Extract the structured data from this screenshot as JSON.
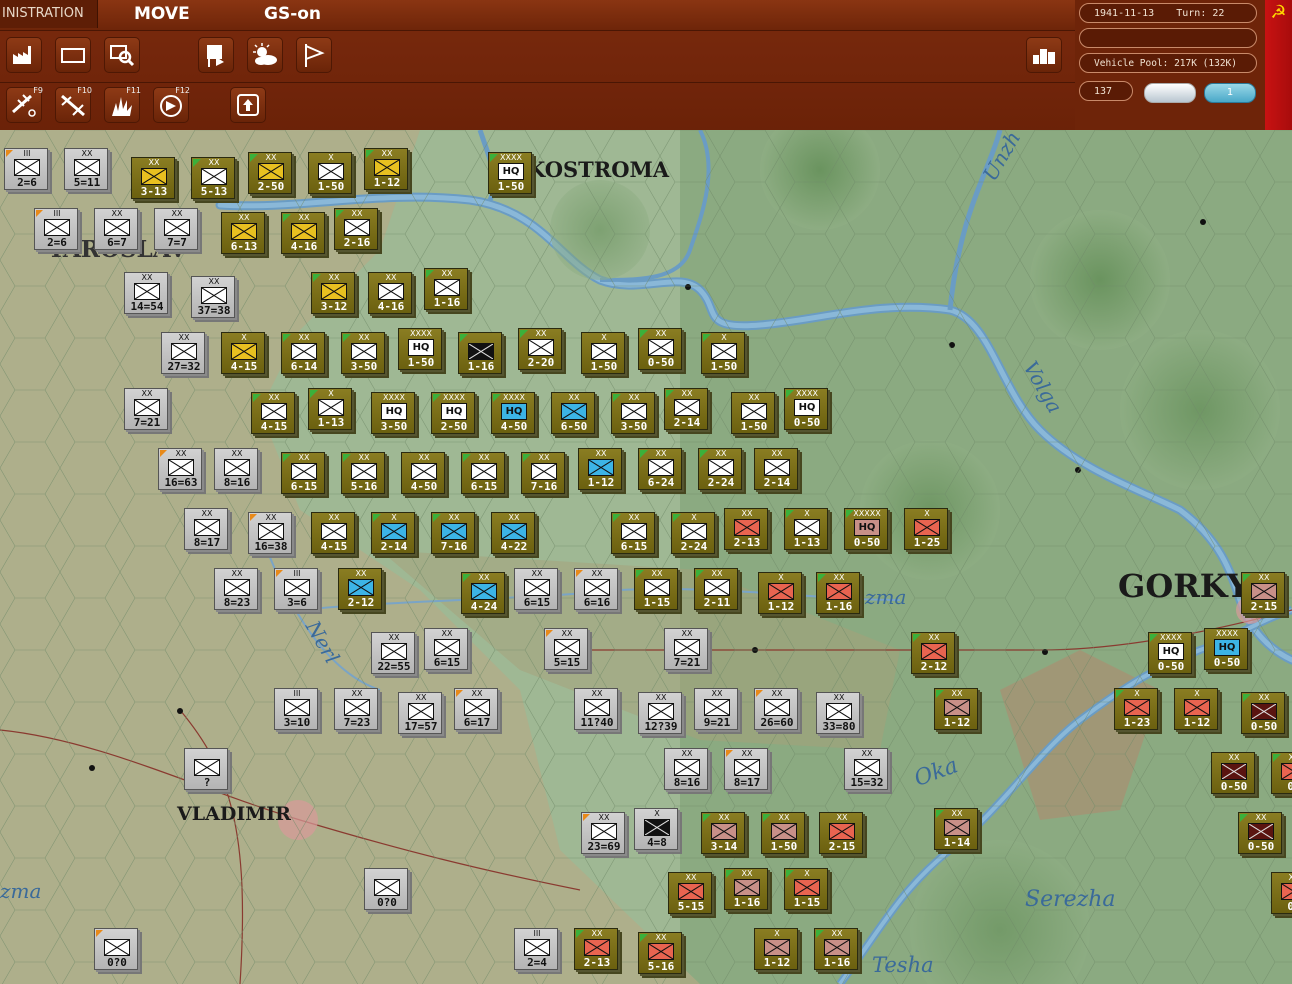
{
  "menu": {
    "admin_tab": "INISTRATION",
    "move_tab": "MOVE",
    "gs_tab": "GS-on"
  },
  "toolbar_row1": [
    {
      "name": "production-icon",
      "glyph": "factory"
    },
    {
      "name": "map-mode-icon",
      "glyph": "rect"
    },
    {
      "name": "search-unit-icon",
      "glyph": "magnify"
    },
    {
      "name": "flag-hq-icon",
      "glyph": "flagdoc"
    },
    {
      "name": "weather-icon",
      "glyph": "weather"
    },
    {
      "name": "victory-flag-icon",
      "glyph": "flag"
    }
  ],
  "toolbar_row2": [
    {
      "name": "air-recon-icon",
      "key": "F9"
    },
    {
      "name": "air-interdiction-icon",
      "key": "F10"
    },
    {
      "name": "bombardment-icon",
      "key": "F11"
    },
    {
      "name": "air-transfer-icon",
      "key": "F12"
    },
    {
      "name": "upload-icon",
      "key": ""
    }
  ],
  "status": {
    "date": "1941-11-13",
    "turn": "Turn: 22",
    "empty_field": "",
    "vehicle_pool": "Vehicle Pool: 217K (132K)",
    "counter_value": "137",
    "badge_number": "1"
  },
  "map_labels": {
    "city_kostroma": "KOSTROMA",
    "city_yaroslavl": "YAROSLAV",
    "city_vladimir": "VLADIMIR",
    "city_gorky": "GORKY",
    "river_volga": "Volga",
    "river_oka": "Oka",
    "river_unzha": "Unzh",
    "river_serezhka": "Serezha",
    "river_tesha": "Tesha",
    "river_nerl": "Nerl",
    "river_klyazma": "zma",
    "river_klyazma_west": "zma"
  },
  "colors": {
    "axis_counter": "#8a7d22",
    "soviet_counter": "#c8c8c8",
    "inf_yellow": "#e8c020",
    "inf_white": "#ffffff",
    "inf_cyan": "#3cb4e6",
    "inf_red": "#e86450",
    "inf_pink": "#c89088",
    "inf_dark": "#5a1410",
    "hq_cyan": "#3cb4e6"
  },
  "units": [
    {
      "side": "sov",
      "size": "III",
      "val": "2=6",
      "fill": "white"
    },
    {
      "side": "sov",
      "size": "XX",
      "val": "5=11",
      "fill": "white"
    },
    {
      "side": "axis",
      "size": "XX",
      "val": "3-13",
      "fill": "yellow"
    },
    {
      "side": "axis",
      "size": "XX",
      "val": "5-13",
      "fill": "white"
    },
    {
      "side": "axis",
      "size": "XX",
      "val": "2-50",
      "fill": "yellow"
    },
    {
      "side": "axis",
      "size": "X",
      "val": "1-50",
      "fill": "white"
    },
    {
      "side": "axis",
      "size": "XX",
      "val": "1-12",
      "fill": "yellow"
    },
    {
      "side": "axis",
      "size": "XXXX",
      "val": "1-50",
      "fill": "hq"
    },
    {
      "side": "sov",
      "size": "III",
      "val": "2=6",
      "fill": "white"
    },
    {
      "side": "sov",
      "size": "XX",
      "val": "6=7",
      "fill": "white"
    },
    {
      "side": "sov",
      "size": "XX",
      "val": "7=7",
      "fill": "white"
    },
    {
      "side": "axis",
      "size": "XX",
      "val": "6-13",
      "fill": "yellow"
    },
    {
      "side": "axis",
      "size": "XX",
      "val": "4-16",
      "fill": "yellow"
    },
    {
      "side": "axis",
      "size": "XX",
      "val": "2-16",
      "fill": "white"
    },
    {
      "side": "sov",
      "size": "XX",
      "val": "14=54",
      "fill": "white"
    },
    {
      "side": "sov",
      "size": "XX",
      "val": "37=38",
      "fill": "white"
    },
    {
      "side": "axis",
      "size": "XX",
      "val": "3-12",
      "fill": "yellow"
    },
    {
      "side": "axis",
      "size": "XX",
      "val": "4-16",
      "fill": "white"
    },
    {
      "side": "axis",
      "size": "XX",
      "val": "1-16",
      "fill": "white"
    },
    {
      "side": "sov",
      "size": "XX",
      "val": "27=32",
      "fill": "white"
    },
    {
      "side": "axis",
      "size": "X",
      "val": "4-15",
      "fill": "yellow"
    },
    {
      "side": "axis",
      "size": "XX",
      "val": "6-14",
      "fill": "white"
    },
    {
      "side": "axis",
      "size": "XX",
      "val": "3-50",
      "fill": "white"
    },
    {
      "side": "axis",
      "size": "XXXX",
      "val": "1-50",
      "fill": "hq"
    },
    {
      "side": "axis",
      "size": "",
      "val": "1-16",
      "fill": "black"
    },
    {
      "side": "axis",
      "size": "XX",
      "val": "2-20",
      "fill": "white"
    },
    {
      "side": "axis",
      "size": "X",
      "val": "1-50",
      "fill": "white"
    },
    {
      "side": "axis",
      "size": "XX",
      "val": "0-50",
      "fill": "white"
    },
    {
      "side": "axis",
      "size": "X",
      "val": "1-50",
      "fill": "white"
    },
    {
      "side": "sov",
      "size": "XX",
      "val": "7=21",
      "fill": "white"
    },
    {
      "side": "axis",
      "size": "XX",
      "val": "4-15",
      "fill": "white"
    },
    {
      "side": "axis",
      "size": "X",
      "val": "1-13",
      "fill": "white"
    },
    {
      "side": "axis",
      "size": "XXXX",
      "val": "3-50",
      "fill": "hq"
    },
    {
      "side": "axis",
      "size": "XXXX",
      "val": "2-50",
      "fill": "hq"
    },
    {
      "side": "axis",
      "size": "XXXX",
      "val": "4-50",
      "fill": "hqcyan"
    },
    {
      "side": "axis",
      "size": "XX",
      "val": "6-50",
      "fill": "cyan"
    },
    {
      "side": "axis",
      "size": "XX",
      "val": "3-50",
      "fill": "white"
    },
    {
      "side": "axis",
      "size": "XX",
      "val": "2-14",
      "fill": "white"
    },
    {
      "side": "axis",
      "size": "XX",
      "val": "1-50",
      "fill": "white"
    },
    {
      "side": "axis",
      "size": "XXXX",
      "val": "0-50",
      "fill": "hq"
    },
    {
      "side": "sov",
      "size": "XX",
      "val": "16=63",
      "fill": "white"
    },
    {
      "side": "sov",
      "size": "XX",
      "val": "8=16",
      "fill": "white"
    },
    {
      "side": "axis",
      "size": "XX",
      "val": "6-15",
      "fill": "white"
    },
    {
      "side": "axis",
      "size": "XX",
      "val": "5-16",
      "fill": "white"
    },
    {
      "side": "axis",
      "size": "XX",
      "val": "4-50",
      "fill": "white"
    },
    {
      "side": "axis",
      "size": "XX",
      "val": "6-15",
      "fill": "white"
    },
    {
      "side": "axis",
      "size": "XX",
      "val": "7-16",
      "fill": "white"
    },
    {
      "side": "axis",
      "size": "XX",
      "val": "1-12",
      "fill": "cyan"
    },
    {
      "side": "axis",
      "size": "XX",
      "val": "6-24",
      "fill": "white"
    },
    {
      "side": "axis",
      "size": "XX",
      "val": "2-24",
      "fill": "white"
    },
    {
      "side": "axis",
      "size": "XX",
      "val": "2-14",
      "fill": "white"
    },
    {
      "side": "sov",
      "size": "XX",
      "val": "8=17",
      "fill": "white"
    },
    {
      "side": "sov",
      "size": "XX",
      "val": "16=38",
      "fill": "white"
    },
    {
      "side": "axis",
      "size": "XX",
      "val": "4-15",
      "fill": "white"
    },
    {
      "side": "axis",
      "size": "X",
      "val": "2-14",
      "fill": "cyan"
    },
    {
      "side": "axis",
      "size": "XX",
      "val": "7-16",
      "fill": "cyan"
    },
    {
      "side": "axis",
      "size": "XX",
      "val": "4-22",
      "fill": "cyan"
    },
    {
      "side": "axis",
      "size": "XX",
      "val": "6-15",
      "fill": "white"
    },
    {
      "side": "axis",
      "size": "X",
      "val": "2-24",
      "fill": "white"
    },
    {
      "side": "axis",
      "size": "XX",
      "val": "2-13",
      "fill": "red"
    },
    {
      "side": "axis",
      "size": "X",
      "val": "1-13",
      "fill": "white"
    },
    {
      "side": "axis",
      "size": "XXXXX",
      "val": "0-50",
      "fill": "hqpink"
    },
    {
      "side": "axis",
      "size": "X",
      "val": "1-25",
      "fill": "red"
    },
    {
      "side": "sov",
      "size": "XX",
      "val": "8=23",
      "fill": "white"
    },
    {
      "side": "sov",
      "size": "III",
      "val": "3=6",
      "fill": "white"
    },
    {
      "side": "axis",
      "size": "XX",
      "val": "2-12",
      "fill": "cyan"
    },
    {
      "side": "axis",
      "size": "XX",
      "val": "4-24",
      "fill": "cyan"
    },
    {
      "side": "sov",
      "size": "XX",
      "val": "6=15",
      "fill": "white"
    },
    {
      "side": "sov",
      "size": "XX",
      "val": "6=16",
      "fill": "white"
    },
    {
      "side": "axis",
      "size": "XX",
      "val": "1-15",
      "fill": "white"
    },
    {
      "side": "axis",
      "size": "XX",
      "val": "2-11",
      "fill": "white"
    },
    {
      "side": "axis",
      "size": "X",
      "val": "1-12",
      "fill": "red"
    },
    {
      "side": "axis",
      "size": "XX",
      "val": "1-16",
      "fill": "red"
    },
    {
      "side": "axis",
      "size": "XX",
      "val": "2-15",
      "fill": "pink"
    },
    {
      "side": "sov",
      "size": "XX",
      "val": "22=55",
      "fill": "white"
    },
    {
      "side": "sov",
      "size": "XX",
      "val": "6=15",
      "fill": "white"
    },
    {
      "side": "sov",
      "size": "XX",
      "val": "5=15",
      "fill": "white"
    },
    {
      "side": "sov",
      "size": "XX",
      "val": "7=21",
      "fill": "white"
    },
    {
      "side": "axis",
      "size": "XX",
      "val": "2-12",
      "fill": "red"
    },
    {
      "side": "axis",
      "size": "XXXX",
      "val": "0-50",
      "fill": "hq"
    },
    {
      "side": "axis",
      "size": "XXXX",
      "val": "0-50",
      "fill": "hqcyan"
    },
    {
      "side": "sov",
      "size": "III",
      "val": "3=10",
      "fill": "white"
    },
    {
      "side": "sov",
      "size": "XX",
      "val": "7=23",
      "fill": "white"
    },
    {
      "side": "sov",
      "size": "XX",
      "val": "17=57",
      "fill": "bluewhite"
    },
    {
      "side": "sov",
      "size": "XX",
      "val": "6=17",
      "fill": "white"
    },
    {
      "side": "sov",
      "size": "XX",
      "val": "11?40",
      "fill": "white"
    },
    {
      "side": "sov",
      "size": "XX",
      "val": "12?39",
      "fill": "white"
    },
    {
      "side": "sov",
      "size": "XX",
      "val": "9=21",
      "fill": "white"
    },
    {
      "side": "sov",
      "size": "XX",
      "val": "26=60",
      "fill": "white"
    },
    {
      "side": "sov",
      "size": "XX",
      "val": "33=80",
      "fill": "white"
    },
    {
      "side": "axis",
      "size": "XX",
      "val": "1-12",
      "fill": "pink"
    },
    {
      "side": "axis",
      "size": "X",
      "val": "1-23",
      "fill": "red"
    },
    {
      "side": "axis",
      "size": "X",
      "val": "1-12",
      "fill": "red"
    },
    {
      "side": "axis",
      "size": "XX",
      "val": "0-50",
      "fill": "dark"
    },
    {
      "side": "sov",
      "size": "",
      "val": "?",
      "fill": "white"
    },
    {
      "side": "sov",
      "size": "XX",
      "val": "8=16",
      "fill": "white"
    },
    {
      "side": "sov",
      "size": "XX",
      "val": "8=17",
      "fill": "white"
    },
    {
      "side": "sov",
      "size": "XX",
      "val": "15=32",
      "fill": "white"
    },
    {
      "side": "axis",
      "size": "XX",
      "val": "0-50",
      "fill": "dark"
    },
    {
      "side": "axis",
      "size": "XX",
      "val": "0-",
      "fill": "red"
    },
    {
      "side": "sov",
      "size": "XX",
      "val": "23=69",
      "fill": "white"
    },
    {
      "side": "sov",
      "size": "X",
      "val": "4=8",
      "fill": "black"
    },
    {
      "side": "axis",
      "size": "XX",
      "val": "3-14",
      "fill": "pink"
    },
    {
      "side": "axis",
      "size": "XX",
      "val": "1-50",
      "fill": "pink"
    },
    {
      "side": "axis",
      "size": "XX",
      "val": "2-15",
      "fill": "red"
    },
    {
      "side": "axis",
      "size": "XX",
      "val": "1-14",
      "fill": "pink"
    },
    {
      "side": "axis",
      "size": "XX",
      "val": "0-50",
      "fill": "dark"
    },
    {
      "side": "axis",
      "size": "XX",
      "val": "5-15",
      "fill": "red"
    },
    {
      "side": "axis",
      "size": "XX",
      "val": "1-16",
      "fill": "pink"
    },
    {
      "side": "axis",
      "size": "X",
      "val": "1-15",
      "fill": "red"
    },
    {
      "side": "axis",
      "size": "XX",
      "val": "0-",
      "fill": "red"
    },
    {
      "side": "sov",
      "size": "",
      "val": "0?0",
      "fill": "white"
    },
    {
      "side": "sov",
      "size": "",
      "val": "0?0",
      "fill": "white"
    },
    {
      "side": "sov",
      "size": "III",
      "val": "2=4",
      "fill": "white"
    },
    {
      "side": "axis",
      "size": "XX",
      "val": "2-13",
      "fill": "red"
    },
    {
      "side": "axis",
      "size": "XX",
      "val": "5-16",
      "fill": "red"
    },
    {
      "side": "axis",
      "size": "X",
      "val": "1-12",
      "fill": "pink"
    },
    {
      "side": "axis",
      "size": "XX",
      "val": "1-16",
      "fill": "pink"
    }
  ]
}
